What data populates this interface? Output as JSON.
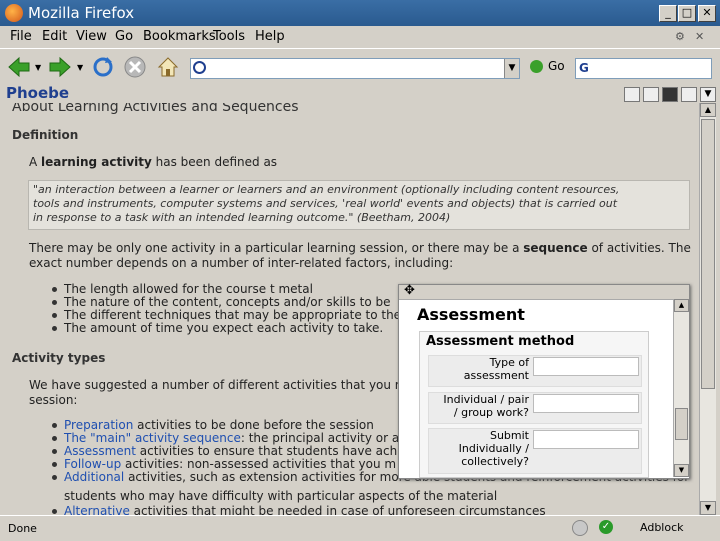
{
  "window": {
    "title": "Mozilla Firefox",
    "minimize": "_",
    "maximize": "□",
    "close": "✕"
  },
  "menu": [
    "File",
    "Edit",
    "View",
    "Go",
    "Bookmarks",
    "Tools",
    "Help"
  ],
  "toolbar": {
    "go_label": "Go",
    "url_value": "",
    "search_value": ""
  },
  "site": {
    "brand": "Phoebe"
  },
  "content": {
    "heading": "About Learning Activities and Sequences",
    "definition_heading": "Definition",
    "def_intro_a": "A ",
    "def_intro_b": "learning activity",
    "def_intro_c": " has been defined as",
    "quote_line1": "\"an interaction between a learner or learners and an environment (optionally including content resources,",
    "quote_line2": "tools and instruments, computer systems and services, 'real world' events and objects) that is carried out",
    "quote_line3": "in response to a task with an intended learning outcome.\" (Beetham, 2004)",
    "para1_a": "There may be only one activity in a particular learning session, or there may be a ",
    "para1_b": "sequence",
    "para1_c": " of activities. The",
    "para1_line2": "exact number depends on a number of inter-related factors, including:",
    "factors": [
      "The length allowed for the course t metal",
      "The nature of the content, concepts and/or skills to be",
      "The different techniques that may be appropriate to the",
      "The amount of time you expect each activity to take."
    ],
    "activity_heading": "Activity types",
    "types_intro_line1": "We have suggested a number of different activities that you r",
    "types_intro_line2": "session:",
    "types": [
      {
        "link": "Preparation",
        "text": " activities to be done before the session"
      },
      {
        "link": "The \"main\" activity sequence",
        "text": ": the principal activity or a"
      },
      {
        "link": "Assessment",
        "text": " activities to ensure that students have ach"
      },
      {
        "link": "Follow-up",
        "text": " activities: non-assessed activities that you m"
      },
      {
        "link": "Additional",
        "text": " activities, such as extension activities for more able students and reinforcement activities for"
      }
    ],
    "types_cont": "students who may have difficulty with particular aspects of the material",
    "types_last": {
      "link": "Alternative",
      "text": " activities that might be needed in case of unforeseen circumstances"
    }
  },
  "popup": {
    "title": "Assessment",
    "section": "Assessment method",
    "rows": [
      {
        "label_line1": "Type of",
        "label_line2": "assessment"
      },
      {
        "label_line1": "Individual / pair",
        "label_line2": "/ group work?"
      },
      {
        "label_line1": "Submit",
        "label_line2": "Individually /",
        "label_line3": "collectively?"
      }
    ]
  },
  "status": {
    "text": "Done",
    "addon": "Adblock"
  }
}
